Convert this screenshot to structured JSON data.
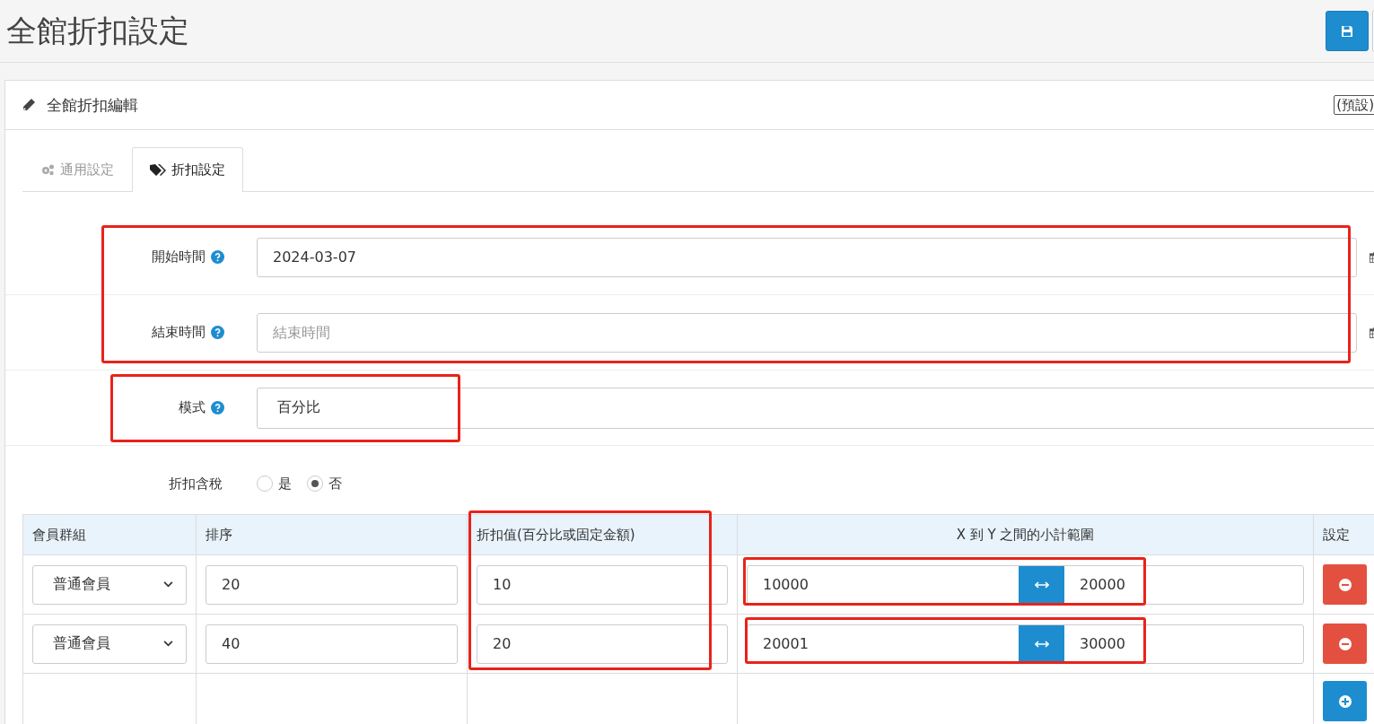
{
  "page_title": "全館折扣設定",
  "panel": {
    "title": "全館折扣編輯",
    "badge": "(預設)"
  },
  "tabs": [
    {
      "label": "通用設定",
      "kind": "gears",
      "selected": false
    },
    {
      "label": "折扣設定",
      "kind": "tags",
      "selected": true
    }
  ],
  "fields": [
    {
      "label": "開始時間",
      "kind": "date",
      "value": "2024-03-07"
    },
    {
      "label": "結束時間",
      "kind": "date",
      "placeholder": "結束時間"
    },
    {
      "label": "模式",
      "kind": "select",
      "value": "百分比"
    }
  ],
  "tax_included": {
    "label": "折扣含稅",
    "options": [
      {
        "label": "是",
        "selected": false
      },
      {
        "label": "否",
        "selected": true
      }
    ]
  },
  "table": {
    "columns": [
      "會員群組",
      "排序",
      "折扣值(百分比或固定金額)",
      "X 到 Y 之間的小計範圍",
      "設定"
    ],
    "rows": [
      {
        "group": "普通會員",
        "sort": "20",
        "value": "10",
        "from": "10000",
        "to": "20000"
      },
      {
        "group": "普通會員",
        "sort": "40",
        "value": "20",
        "from": "20001",
        "to": "30000"
      }
    ]
  },
  "annotations": [
    {
      "kind": "frame"
    },
    {
      "kind": "frame"
    },
    {
      "kind": "frame"
    },
    {
      "kind": "frame"
    },
    {
      "kind": "frame"
    }
  ]
}
